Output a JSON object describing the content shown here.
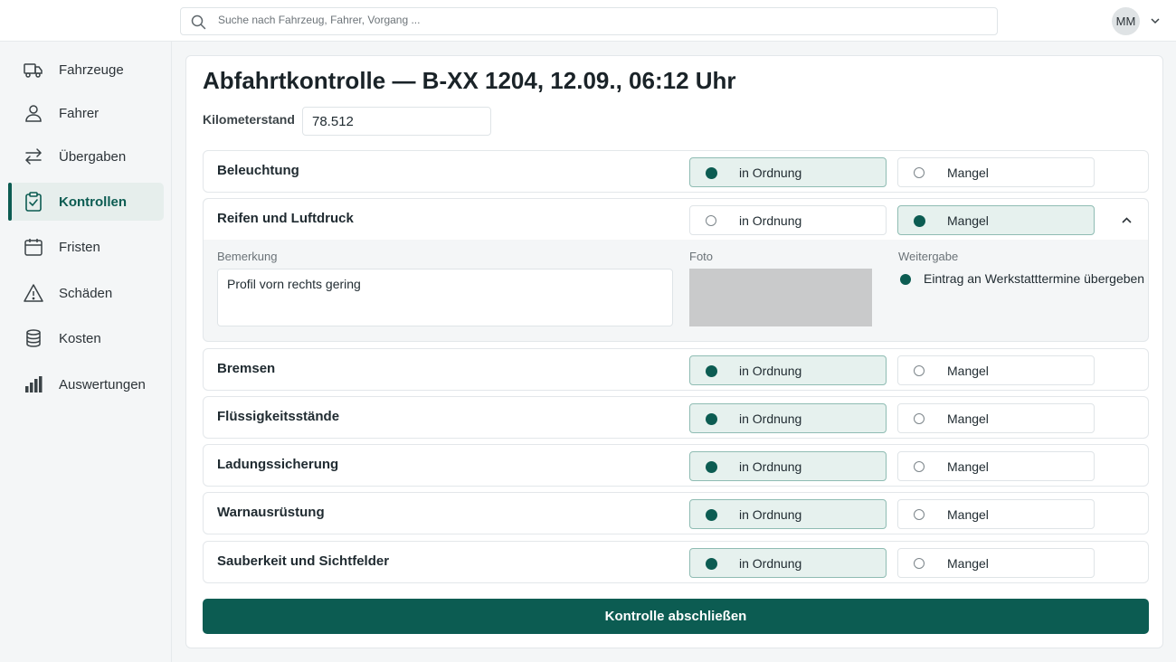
{
  "search": {
    "placeholder": "Suche nach Fahrzeug, Fahrer, Vorgang ..."
  },
  "user": {
    "initials": "MM"
  },
  "sidebar": {
    "items": [
      {
        "label": "Fahrzeuge",
        "icon": "truck-icon"
      },
      {
        "label": "Fahrer",
        "icon": "person-icon"
      },
      {
        "label": "Übergaben",
        "icon": "swap-arrows-icon"
      },
      {
        "label": "Kontrollen",
        "icon": "clipboard-check-icon",
        "active": true
      },
      {
        "label": "Fristen",
        "icon": "calendar-icon"
      },
      {
        "label": "Schäden",
        "icon": "warning-triangle-icon"
      },
      {
        "label": "Kosten",
        "icon": "coin-stack-icon"
      },
      {
        "label": "Auswertungen",
        "icon": "bar-chart-icon"
      }
    ]
  },
  "page": {
    "title": "Abfahrtkontrolle — B-XX 1204, 12.09., 06:12 Uhr",
    "km_label": "Kilometerstand",
    "km_value": "78.512"
  },
  "options": {
    "ok": "in Ordnung",
    "defect": "Mangel"
  },
  "checks": [
    {
      "name": "Beleuchtung",
      "status": "ok"
    },
    {
      "name": "Reifen und Luftdruck",
      "status": "defect",
      "expanded": true
    },
    {
      "name": "Bremsen",
      "status": "ok"
    },
    {
      "name": "Flüssigkeitsstände",
      "status": "ok"
    },
    {
      "name": "Ladungssicherung",
      "status": "ok"
    },
    {
      "name": "Warnausrüstung",
      "status": "ok"
    },
    {
      "name": "Sauberkeit und Sichtfelder",
      "status": "ok"
    }
  ],
  "detail": {
    "remark_label": "Bemerkung",
    "remark_value": "Profil vorn rechts gering",
    "photo_label": "Foto",
    "handover_label": "Weitergabe",
    "handover_text": "Eintrag an Werkstatttermine übergeben"
  },
  "submit_label": "Kontrolle abschließen",
  "colors": {
    "accent": "#0c5c52",
    "selected_bg": "#e6f1ee",
    "photo_placeholder": "#c9cacb"
  }
}
